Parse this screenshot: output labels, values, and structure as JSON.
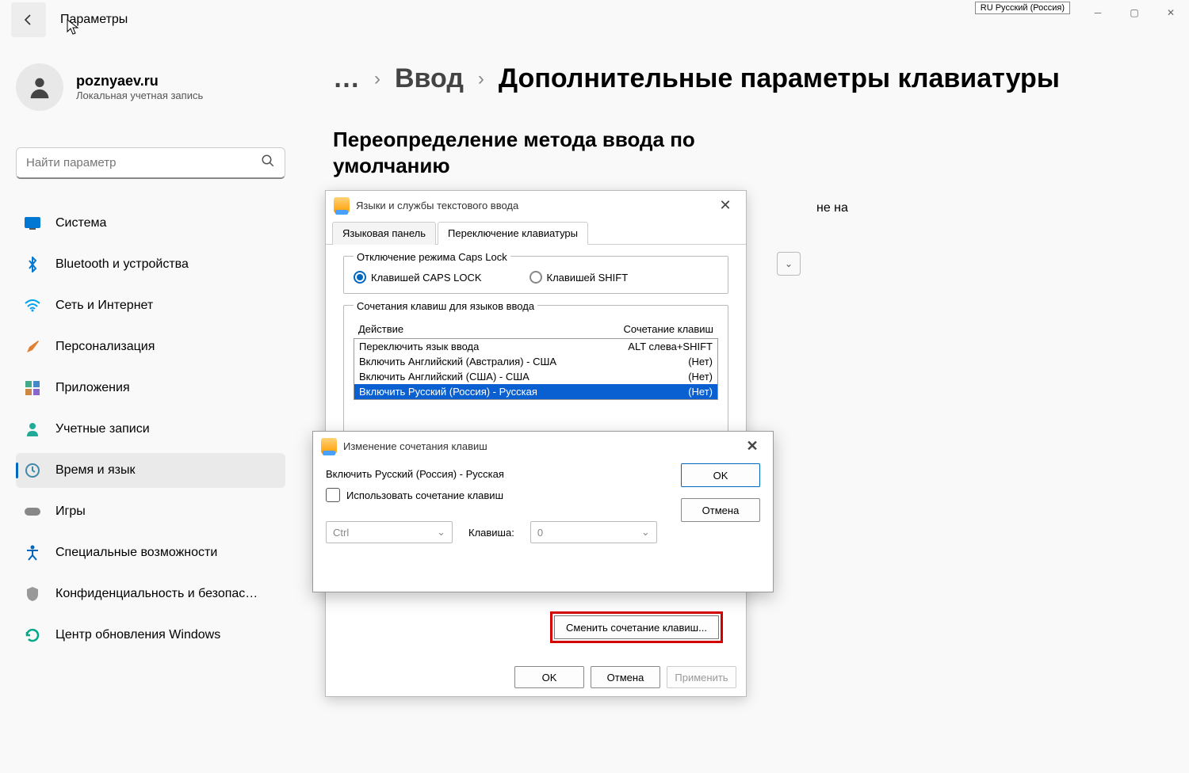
{
  "titlebar": {
    "app_title": "Параметры",
    "lang_indicator": "RU Русский (Россия)"
  },
  "user": {
    "name": "poznyaev.ru",
    "subtitle": "Локальная учетная запись"
  },
  "search": {
    "placeholder": "Найти параметр"
  },
  "nav": {
    "items": [
      {
        "label": "Система"
      },
      {
        "label": "Bluetooth и устройства"
      },
      {
        "label": "Сеть и Интернет"
      },
      {
        "label": "Персонализация"
      },
      {
        "label": "Приложения"
      },
      {
        "label": "Учетные записи"
      },
      {
        "label": "Время и язык"
      },
      {
        "label": "Игры"
      },
      {
        "label": "Специальные возможности"
      },
      {
        "label": "Конфиденциальность и безопасность"
      },
      {
        "label": "Центр обновления Windows"
      }
    ]
  },
  "breadcrumb": {
    "dots": "…",
    "lvl1": "Ввод",
    "lvl2": "Дополнительные параметры клавиатуры"
  },
  "section_heading": "Переопределение метода ввода по умолчанию",
  "bg_text_fragment": "не на",
  "dialog1": {
    "title": "Языки и службы текстового ввода",
    "tabs": {
      "t1": "Языковая панель",
      "t2": "Переключение клавиатуры"
    },
    "caps_group": {
      "legend": "Отключение режима Caps Lock",
      "opt1": "Клавишей CAPS LOCK",
      "opt2": "Клавишей SHIFT"
    },
    "hotkeys_group": {
      "legend": "Сочетания клавиш для языков ввода",
      "col1": "Действие",
      "col2": "Сочетание клавиш",
      "rows": [
        {
          "action": "Переключить язык ввода",
          "key": "ALT слева+SHIFT"
        },
        {
          "action": "Включить Английский (Австралия) - США",
          "key": "(Нет)"
        },
        {
          "action": "Включить Английский (США) - США",
          "key": "(Нет)"
        },
        {
          "action": "Включить Русский (Россия) - Русская",
          "key": "(Нет)"
        }
      ],
      "change_btn": "Сменить сочетание клавиш..."
    },
    "footer": {
      "ok": "OK",
      "cancel": "Отмена",
      "apply": "Применить"
    }
  },
  "dialog2": {
    "title": "Изменение сочетания клавиш",
    "subtitle": "Включить Русский (Россия) - Русская",
    "checkbox_label": "Использовать сочетание клавиш",
    "modifier": "Ctrl",
    "key_label": "Клавиша:",
    "key_value": "0",
    "ok": "OK",
    "cancel": "Отмена"
  }
}
